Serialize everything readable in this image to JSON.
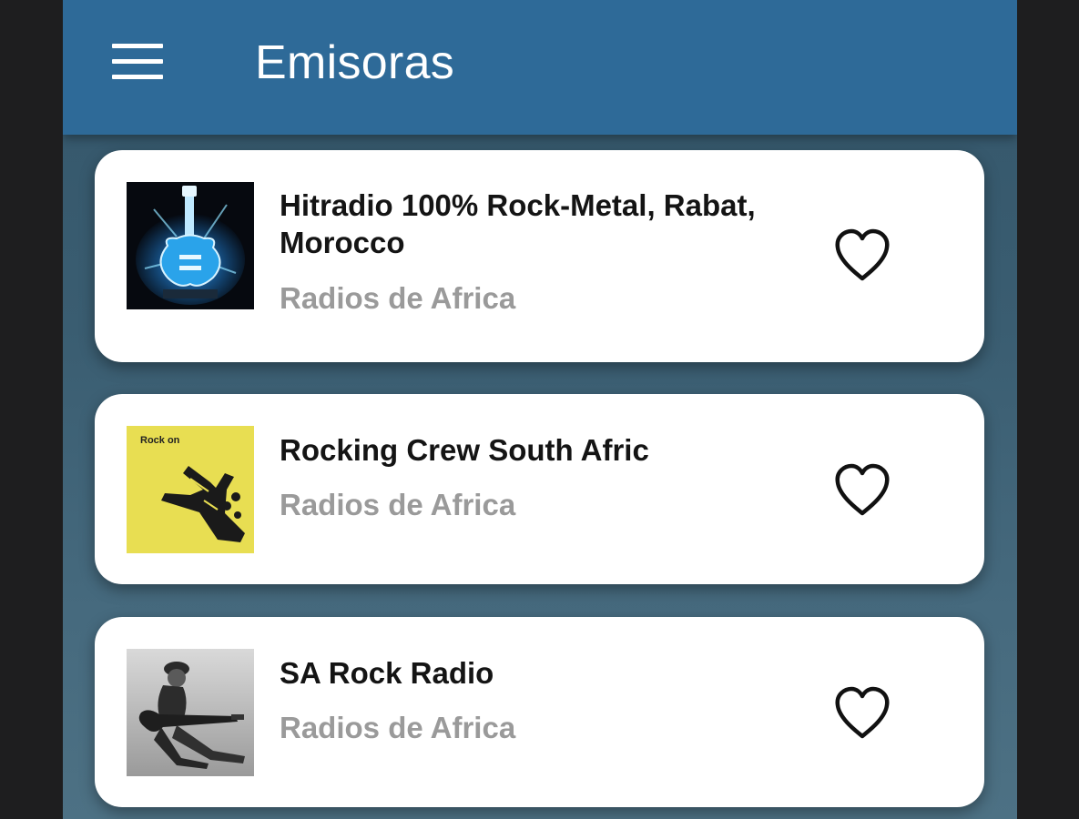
{
  "appbar": {
    "title": "Emisoras",
    "menu_icon": "hamburger-menu-icon",
    "color": "#2e6a98"
  },
  "stations": [
    {
      "name": "Hitradio 100% Rock-Metal, Rabat, Morocco",
      "category": "Radios de Africa",
      "thumbnail": "electric-guitar-artwork",
      "favorite_icon": "heart-outline-icon"
    },
    {
      "name": "Rocking Crew South Afric",
      "category": "Radios de Africa",
      "thumbnail": "rock-on-hand-artwork",
      "thumbnail_text": "Rock on",
      "favorite_icon": "heart-outline-icon"
    },
    {
      "name": "SA Rock Radio",
      "category": "Radios de Africa",
      "thumbnail": "guitarist-photo",
      "favorite_icon": "heart-outline-icon"
    }
  ]
}
